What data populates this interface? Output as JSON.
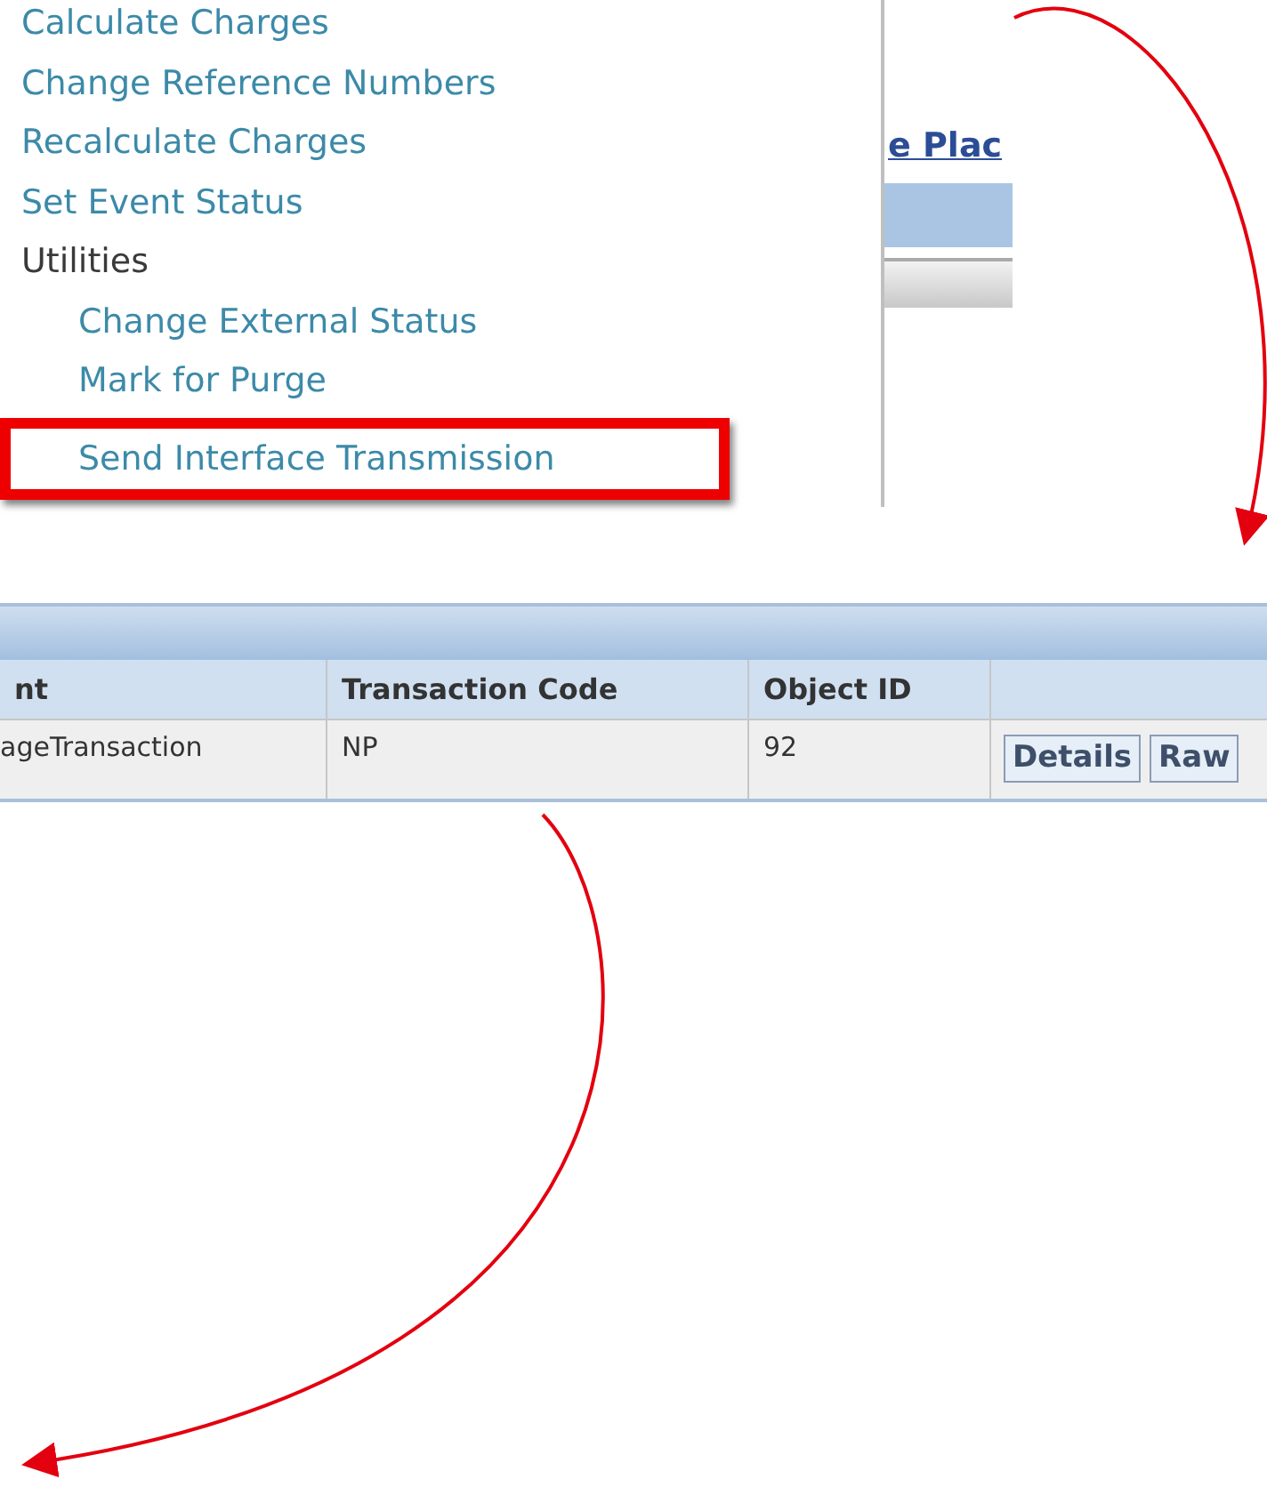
{
  "menu": {
    "items": [
      {
        "label": "Calculate Charges",
        "kind": "link",
        "highlighted": false
      },
      {
        "label": "Change Reference Numbers",
        "kind": "link",
        "highlighted": false
      },
      {
        "label": "Recalculate Charges",
        "kind": "link",
        "highlighted": false
      },
      {
        "label": "Set Event Status",
        "kind": "link",
        "highlighted": false
      },
      {
        "label": "Utilities",
        "kind": "group",
        "highlighted": false,
        "children": [
          {
            "label": "Change External Status",
            "kind": "link",
            "highlighted": false
          },
          {
            "label": "Mark for Purge",
            "kind": "link",
            "highlighted": false
          },
          {
            "label": "Send Interface Transmission",
            "kind": "link",
            "highlighted": true
          }
        ]
      }
    ]
  },
  "page_fragment": {
    "link": "e Plac"
  },
  "table": {
    "columns": [
      "nt",
      "Transaction Code",
      "Object ID"
    ],
    "rows": [
      {
        "cells": [
          "ageTransaction",
          "NP",
          "92"
        ],
        "actions": [
          "Details",
          "Raw"
        ]
      }
    ]
  }
}
